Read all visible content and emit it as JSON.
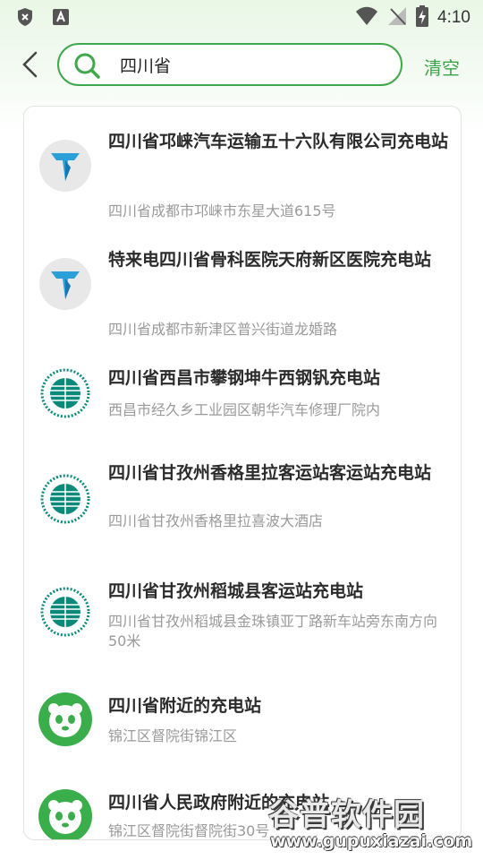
{
  "status_bar": {
    "time": "4:10"
  },
  "search": {
    "query": "四川省",
    "clear_label": "清空"
  },
  "results": [
    {
      "name": "四川省邛崃汽车运输五十六队有限公司充电站",
      "address": "四川省成都市邛崃市东星大道615号",
      "logo": "telaidian-logo"
    },
    {
      "name": "特来电四川省骨科医院天府新区医院充电站",
      "address": "四川省成都市新津区普兴街道龙婚路",
      "logo": "telaidian-logo"
    },
    {
      "name": "四川省西昌市攀钢坤牛西钢钒充电站",
      "address": "西昌市经久乡工业园区朝华汽车修理厂院内",
      "logo": "state-grid-logo"
    },
    {
      "name": "四川省甘孜州香格里拉客运站客运站充电站",
      "address": "四川省甘孜州香格里拉喜波大酒店",
      "logo": "state-grid-logo"
    },
    {
      "name": "四川省甘孜州稻城县客运站充电站",
      "address": "四川省甘孜州稻城县金珠镇亚丁路新车站旁东南方向50米",
      "logo": "state-grid-logo"
    },
    {
      "name": "四川省附近的充电站",
      "address": "锦江区督院街锦江区",
      "logo": "panda-logo"
    },
    {
      "name": "四川省人民政府附近的充电站",
      "address": "锦江区督院街督院街30号",
      "logo": "panda-logo"
    }
  ],
  "watermark": {
    "title": "谷普软件园",
    "url": "www.gupuxiazai.com"
  },
  "colors": {
    "accent": "#3fa84a",
    "title": "#2b2b2b",
    "subtitle": "#9a9a9a"
  }
}
